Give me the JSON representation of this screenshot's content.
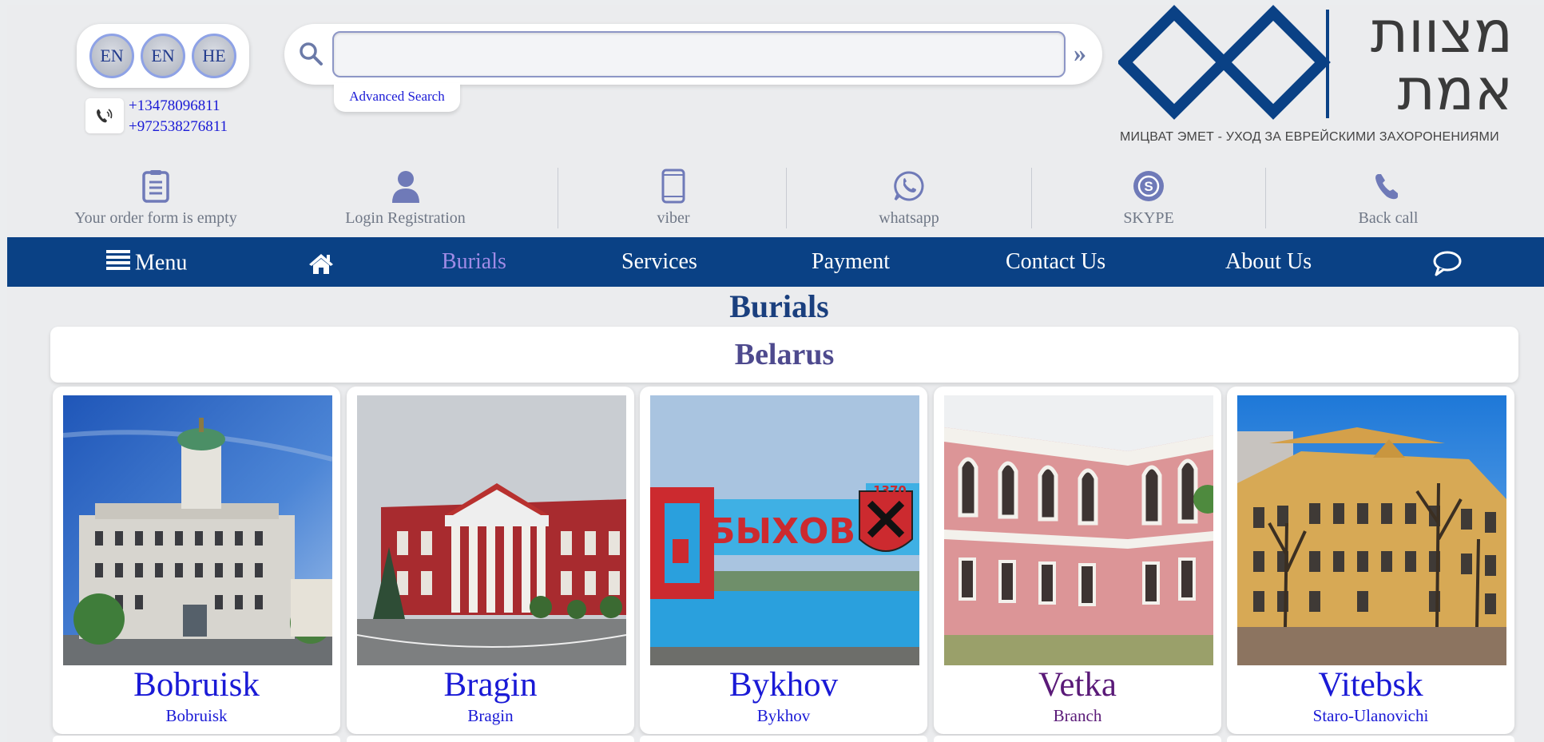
{
  "languages": [
    "EN",
    "EN",
    "HE"
  ],
  "contact": {
    "phones": [
      "+13478096811",
      "+972538276811"
    ]
  },
  "search": {
    "value": "",
    "placeholder": "",
    "go_glyph": "»",
    "advanced_label": "Advanced Search"
  },
  "logo": {
    "hebrew_line1": "מצוות",
    "hebrew_line2": "אמת",
    "subtitle": "МИЦВАТ ЭМЕТ - УХОД ЗА ЕВРЕЙСКИМИ ЗАХОРОНЕНИЯМИ",
    "color": "#0a4185"
  },
  "quickbar": [
    {
      "label": "Your order form is empty",
      "icon": "clipboard-icon"
    },
    {
      "label": "Login Registration",
      "icon": "user-icon"
    },
    {
      "label": "viber",
      "icon": "smartphone-icon"
    },
    {
      "label": "whatsapp",
      "icon": "whatsapp-icon"
    },
    {
      "label": "SKYPE",
      "icon": "skype-icon"
    },
    {
      "label": "Back call",
      "icon": "phone-icon"
    }
  ],
  "nav": {
    "menu_label": "Menu",
    "items": [
      "Burials",
      "Services",
      "Payment",
      "Contact Us",
      "About Us"
    ],
    "active": "Burials"
  },
  "page": {
    "title": "Burials",
    "country": "Belarus"
  },
  "cards": [
    {
      "title": "Bobruisk",
      "subtitle": "Bobruisk",
      "visited": false
    },
    {
      "title": "Bragin",
      "subtitle": "Bragin",
      "visited": false
    },
    {
      "title": "Bykhov",
      "subtitle": "Bykhov",
      "visited": false
    },
    {
      "title": "Vetka",
      "subtitle": "Branch",
      "visited": true
    },
    {
      "title": "Vitebsk",
      "subtitle": "Staro-Ulanovichi",
      "visited": false
    }
  ],
  "sign_text": {
    "bykhov": "БЫХОВ",
    "bykhov_year": "1370"
  },
  "colors": {
    "nav_bg": "#0a4185",
    "link": "#1a1ad6",
    "visited": "#5a1a78",
    "active_nav": "#a08be6",
    "title": "#1a3f7e"
  }
}
